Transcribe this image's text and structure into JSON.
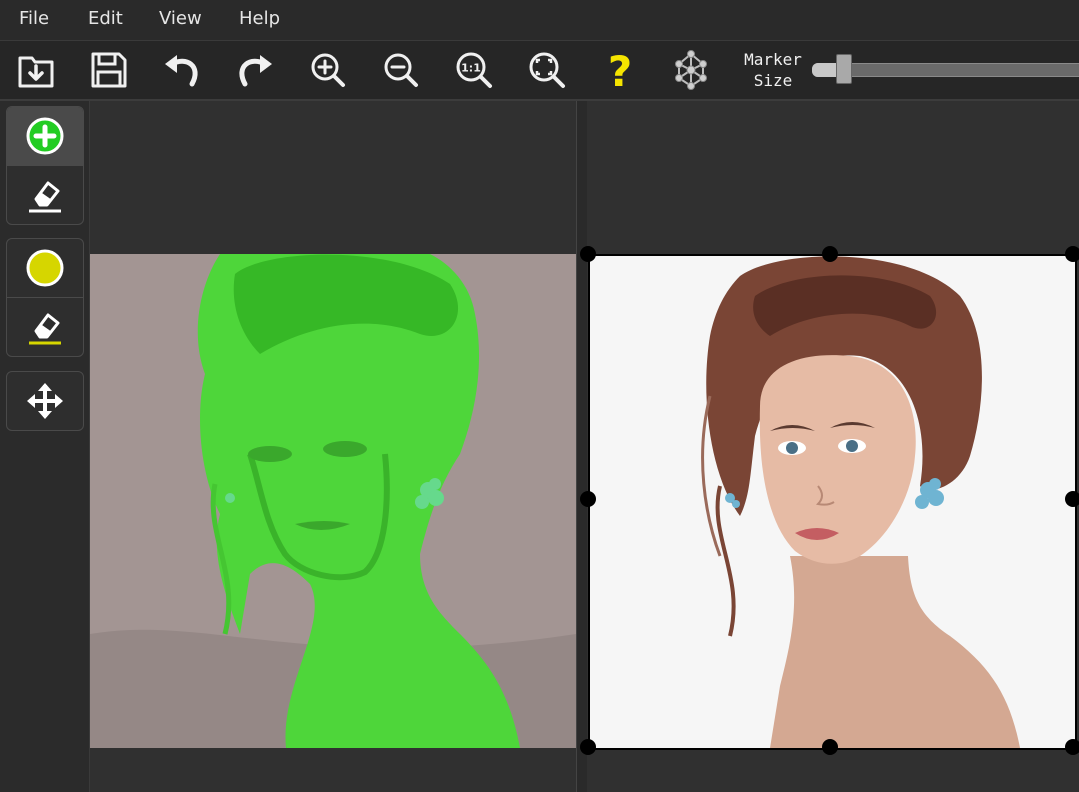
{
  "menu": {
    "items": [
      {
        "label": "File"
      },
      {
        "label": "Edit"
      },
      {
        "label": "View"
      },
      {
        "label": "Help"
      }
    ]
  },
  "toolbar": {
    "buttons": [
      {
        "icon": "open-folder-icon"
      },
      {
        "icon": "save-icon"
      },
      {
        "icon": "undo-icon"
      },
      {
        "icon": "redo-icon"
      },
      {
        "icon": "zoom-in-icon"
      },
      {
        "icon": "zoom-out-icon"
      },
      {
        "icon": "zoom-actual-size-icon",
        "label": "1:1"
      },
      {
        "icon": "zoom-fit-icon"
      },
      {
        "icon": "help-icon",
        "label": "?"
      },
      {
        "icon": "network-icon"
      }
    ],
    "marker_size": {
      "label_line1": "Marker",
      "label_line2": "Size",
      "level": 0.05
    }
  },
  "tools": {
    "foreground_add": {
      "icon": "add-foreground-icon",
      "color": "#22cc22"
    },
    "foreground_erase": {
      "icon": "eraser-icon"
    },
    "background_add": {
      "icon": "add-background-icon",
      "color": "#d6d600"
    },
    "background_erase": {
      "icon": "eraser-icon"
    },
    "move": {
      "icon": "move-icon"
    }
  },
  "colors": {
    "foreground_mask": "#4ed63a",
    "background_tint": "#a39593",
    "help_yellow": "#f5e400",
    "result_background": "#f6f6f6"
  }
}
